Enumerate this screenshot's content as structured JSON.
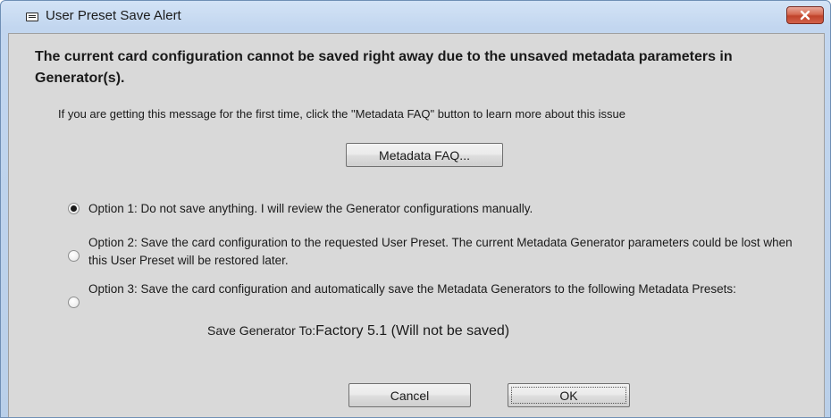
{
  "window": {
    "title": "User Preset Save Alert",
    "icon": "window-icon",
    "close_icon": "close-icon"
  },
  "dialog": {
    "heading": "The current card configuration cannot be saved right away due to the unsaved metadata parameters in Generator(s).",
    "info": "If you are getting this message for the first time, click the \"Metadata FAQ\" button to learn more about this issue",
    "faq_button": "Metadata FAQ...",
    "options": [
      {
        "label": "Option 1: Do not save anything. I will review the Generator configurations manually.",
        "selected": true
      },
      {
        "label": "Option 2: Save the card configuration to the requested User Preset. The current Metadata Generator parameters could be lost when this User Preset will be restored later.",
        "selected": false
      },
      {
        "label": "Option 3: Save the card configuration and automatically save the Metadata Generators to the following Metadata Presets:",
        "selected": false
      }
    ],
    "save_to_label": "Save Generator To:",
    "save_to_value": "Factory 5.1 (Will not be saved)",
    "cancel_button": "Cancel",
    "ok_button": "OK"
  },
  "colors": {
    "titlebar": "#c2d6ef",
    "client_background": "#d9d9d9",
    "close_button": "#c0432b"
  }
}
